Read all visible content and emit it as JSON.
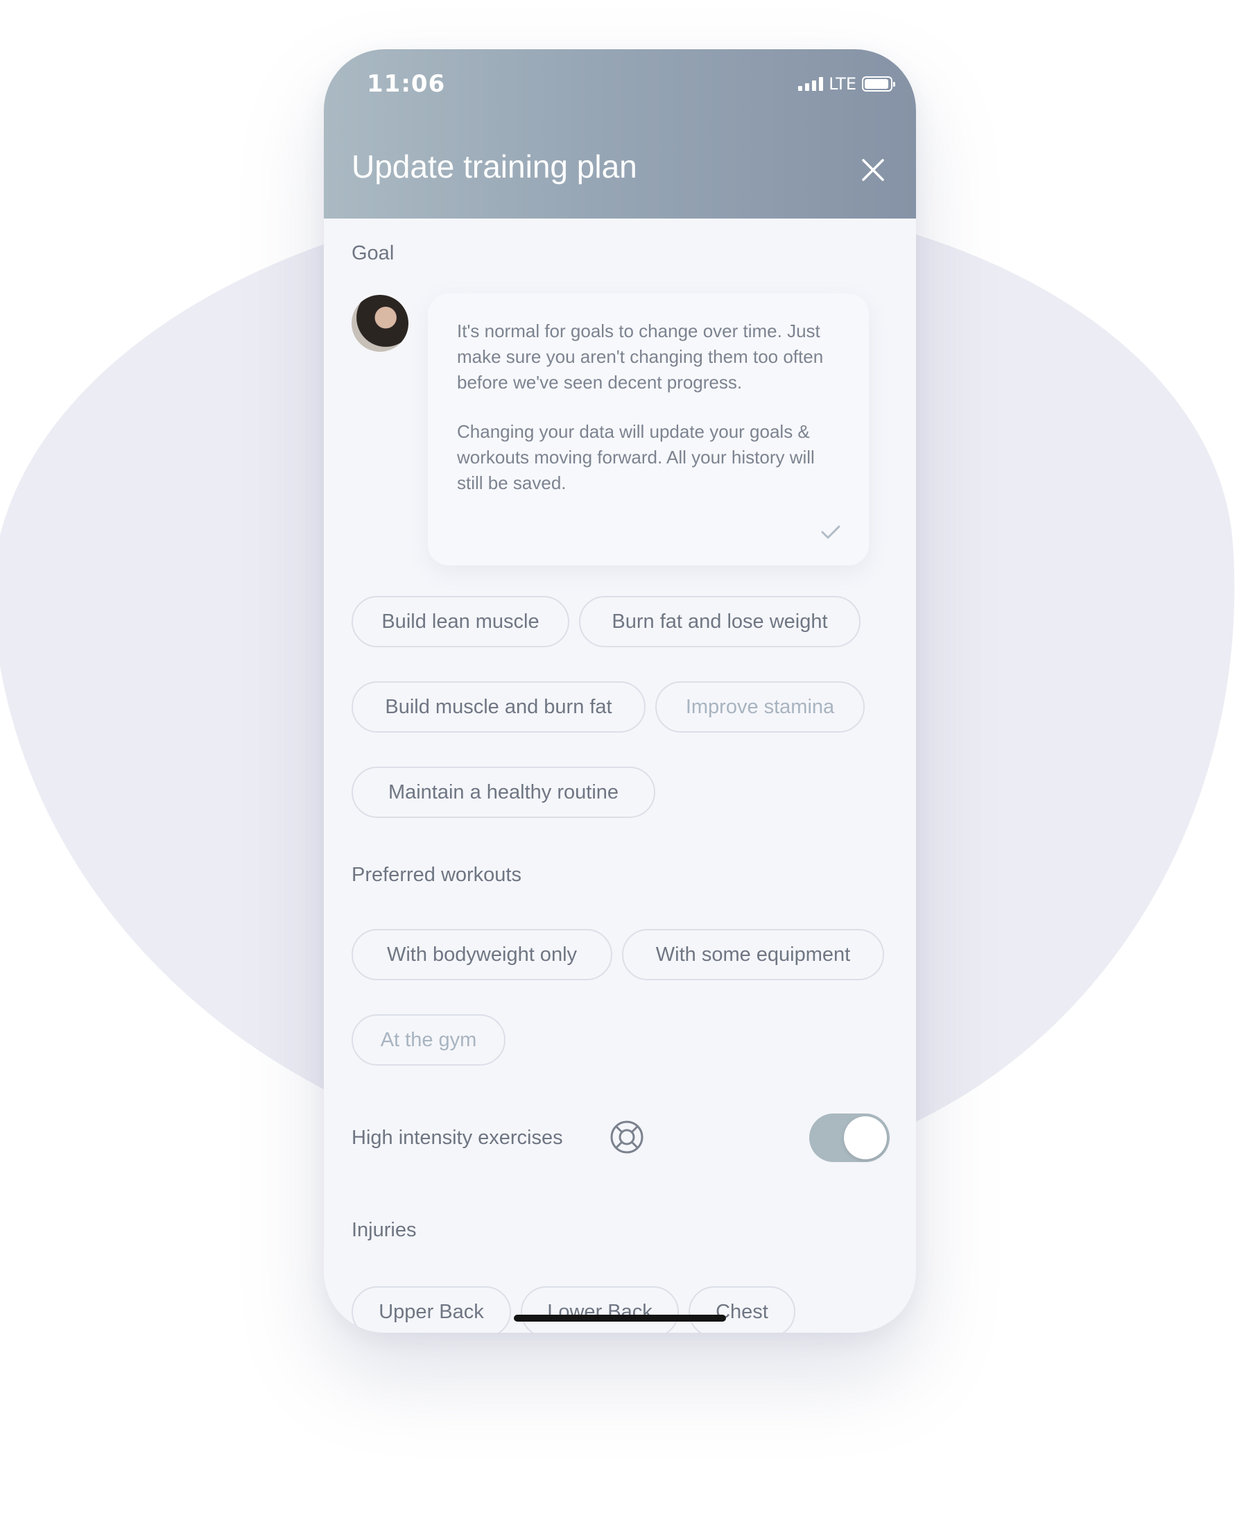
{
  "status_bar": {
    "time": "11:06",
    "network": "LTE"
  },
  "header": {
    "title": "Update training plan",
    "close_icon": "close-icon"
  },
  "goal_section": {
    "label": "Goal",
    "message_paragraph_1": "It's normal for goals to change over time. Just make sure you aren't changing them too often before we've seen decent progress.",
    "message_paragraph_2": "Changing your data will update your goals & workouts moving forward. All your history will still be saved.",
    "options": [
      "Build lean muscle",
      "Burn fat and lose weight",
      "Build muscle and burn fat",
      "Improve stamina",
      "Maintain a healthy routine"
    ]
  },
  "workouts_section": {
    "label": "Preferred workouts",
    "options": [
      "With bodyweight only",
      "With some equipment",
      "At the gym"
    ]
  },
  "intensity": {
    "label": "High intensity exercises",
    "icon": "lifebuoy-icon",
    "enabled": true
  },
  "injuries_section": {
    "label": "Injuries",
    "options": [
      "Upper Back",
      "Lower Back",
      "Chest"
    ]
  },
  "colors": {
    "header_start": "#aab9c2",
    "header_end": "#8693a6",
    "toggle_on": "#aab8c0",
    "chip_border": "#dcdfe7"
  }
}
